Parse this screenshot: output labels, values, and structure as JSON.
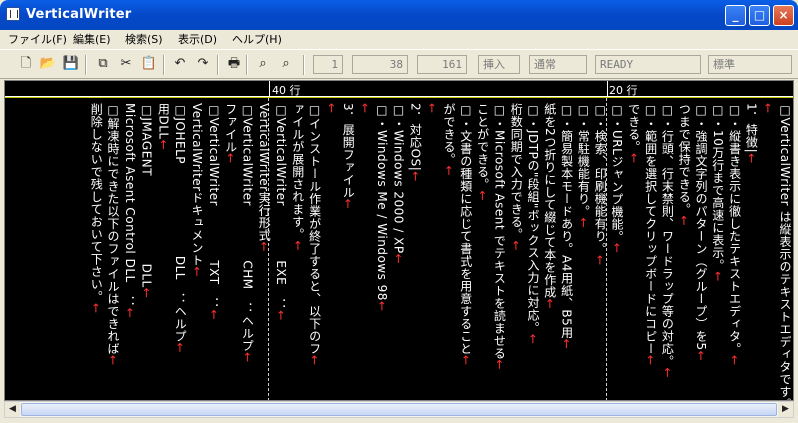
{
  "window": {
    "title": "VerticalWriter"
  },
  "window_controls": {
    "minimize": "_",
    "maximize": "□",
    "close": "×"
  },
  "menu": [
    "ファイル(F)",
    "編集(E)",
    "検索(S)",
    "表示(D)",
    "ヘルプ(H)"
  ],
  "toolbar": {
    "icons": [
      "new-file-icon",
      "open-folder-icon",
      "save-icon",
      "copy-icon",
      "cut-icon",
      "paste-icon",
      "undo-icon",
      "redo-icon",
      "print-icon",
      "find-icon",
      "find-next-icon"
    ],
    "glyphs": [
      "🗋",
      "📂",
      "💾",
      "⧉",
      "✂",
      "📋",
      "↶",
      "↷",
      "🖶",
      "⌕",
      "⌕"
    ],
    "fields": [
      "1",
      "38",
      "161",
      "挿入",
      "通常",
      "READY",
      "標準"
    ]
  },
  "ruler": {
    "mark40": "40 行",
    "mark20": "20 行"
  },
  "columns": [
    [
      "□VerticalWriter は縦表示のテキストエ",
      "ディタです。"
    ],
    [
      ""
    ],
    [
      "1．特徴",
      "|"
    ],
    [
      "□・縦書き表示に徹したテキストエディタ。"
    ],
    [
      "□・10万行まで高速に表示。"
    ],
    [
      "□・強調文字列のパターン（グループ）を5"
    ],
    [
      "つまで保持できる。"
    ],
    [
      "□・行頭、行末禁則、ワードラップ等の対応。"
    ],
    [
      "□・範囲を選択してクリップボードにコピー"
    ],
    [
      "できる。"
    ],
    [
      "□・URLジャンプ機能。"
    ],
    [
      "□・検索、印刷機能有り。"
    ],
    [
      "□・常駐機能有り。"
    ],
    [
      "□・簡易製本モードあり。A4用紙、B5用"
    ],
    [
      "紙を2つ折りにして綴じて本を作成"
    ],
    [
      "□・JDTPの\"段組\"ボックス入力に対応。"
    ],
    [
      "桁数同期で入力できる。"
    ],
    [
      "□・Microsoft Asent でテキストを読ませる"
    ],
    [
      "ことができる。"
    ],
    [
      "□・文書の種類に応じて書式を用意すること"
    ],
    [
      "ができる。"
    ],
    [
      ""
    ],
    [
      "2．対応OS",
      "|"
    ],
    [
      "□・Windows 2000 / XP"
    ],
    [
      "□・Windows Me / Windows 98"
    ],
    [
      ""
    ],
    [
      "3．展開ファイル"
    ],
    [
      ""
    ],
    [
      "□インストール作業が終了すると、以下のフ"
    ],
    [
      "ァイルが展開されます。"
    ],
    [
      "□VerticalWriter　　　　 EXE　："
    ],
    [
      "VerticalWriter実行形式"
    ],
    [
      "□VerticalWriter　　　　 CHM　：ヘルプ"
    ],
    [
      "ファイル"
    ],
    [
      "□VerticalWriter　　　　 TXT　："
    ],
    [
      "VerticalWriterドキュメント"
    ],
    [
      "□JOHELP　　　　　　　 DLL　：ヘルプ"
    ],
    [
      "用DLL"
    ],
    [
      "□JMAGENT　　　　　　　DLL"
    ],
    [
      "Microsoft Asent Control DLL　："
    ],
    [
      "□解凍時にできた以下のファイルはできれば"
    ],
    [
      "削除しないで残しておいて下さい。"
    ]
  ],
  "colors": {
    "text": "#ffffff",
    "return_mark": "#ff3030",
    "background": "#000000",
    "baseline": "#c8c800"
  }
}
